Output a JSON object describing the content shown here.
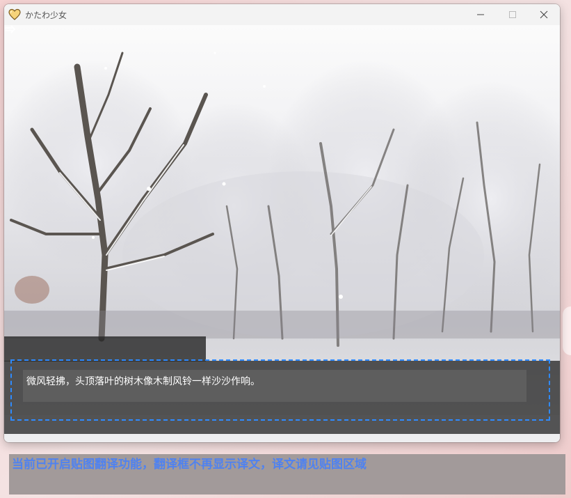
{
  "window": {
    "title": "かたわ少女",
    "icon": "heart-icon"
  },
  "scene": {
    "description_icon": "snowy-forest-background"
  },
  "dialog": {
    "text": "微风轻拂，头顶落叶的树木像木制风铃一样沙沙作响。",
    "advance_icon": "arrow-right-icon"
  },
  "notice": {
    "text": "当前已开启贴图翻译功能，翻译框不再显示译文，译文请见贴图区域"
  },
  "colors": {
    "selection_border": "#2f8bff",
    "notice_text": "#4f82f0",
    "notice_bg": "#a29a9a"
  }
}
